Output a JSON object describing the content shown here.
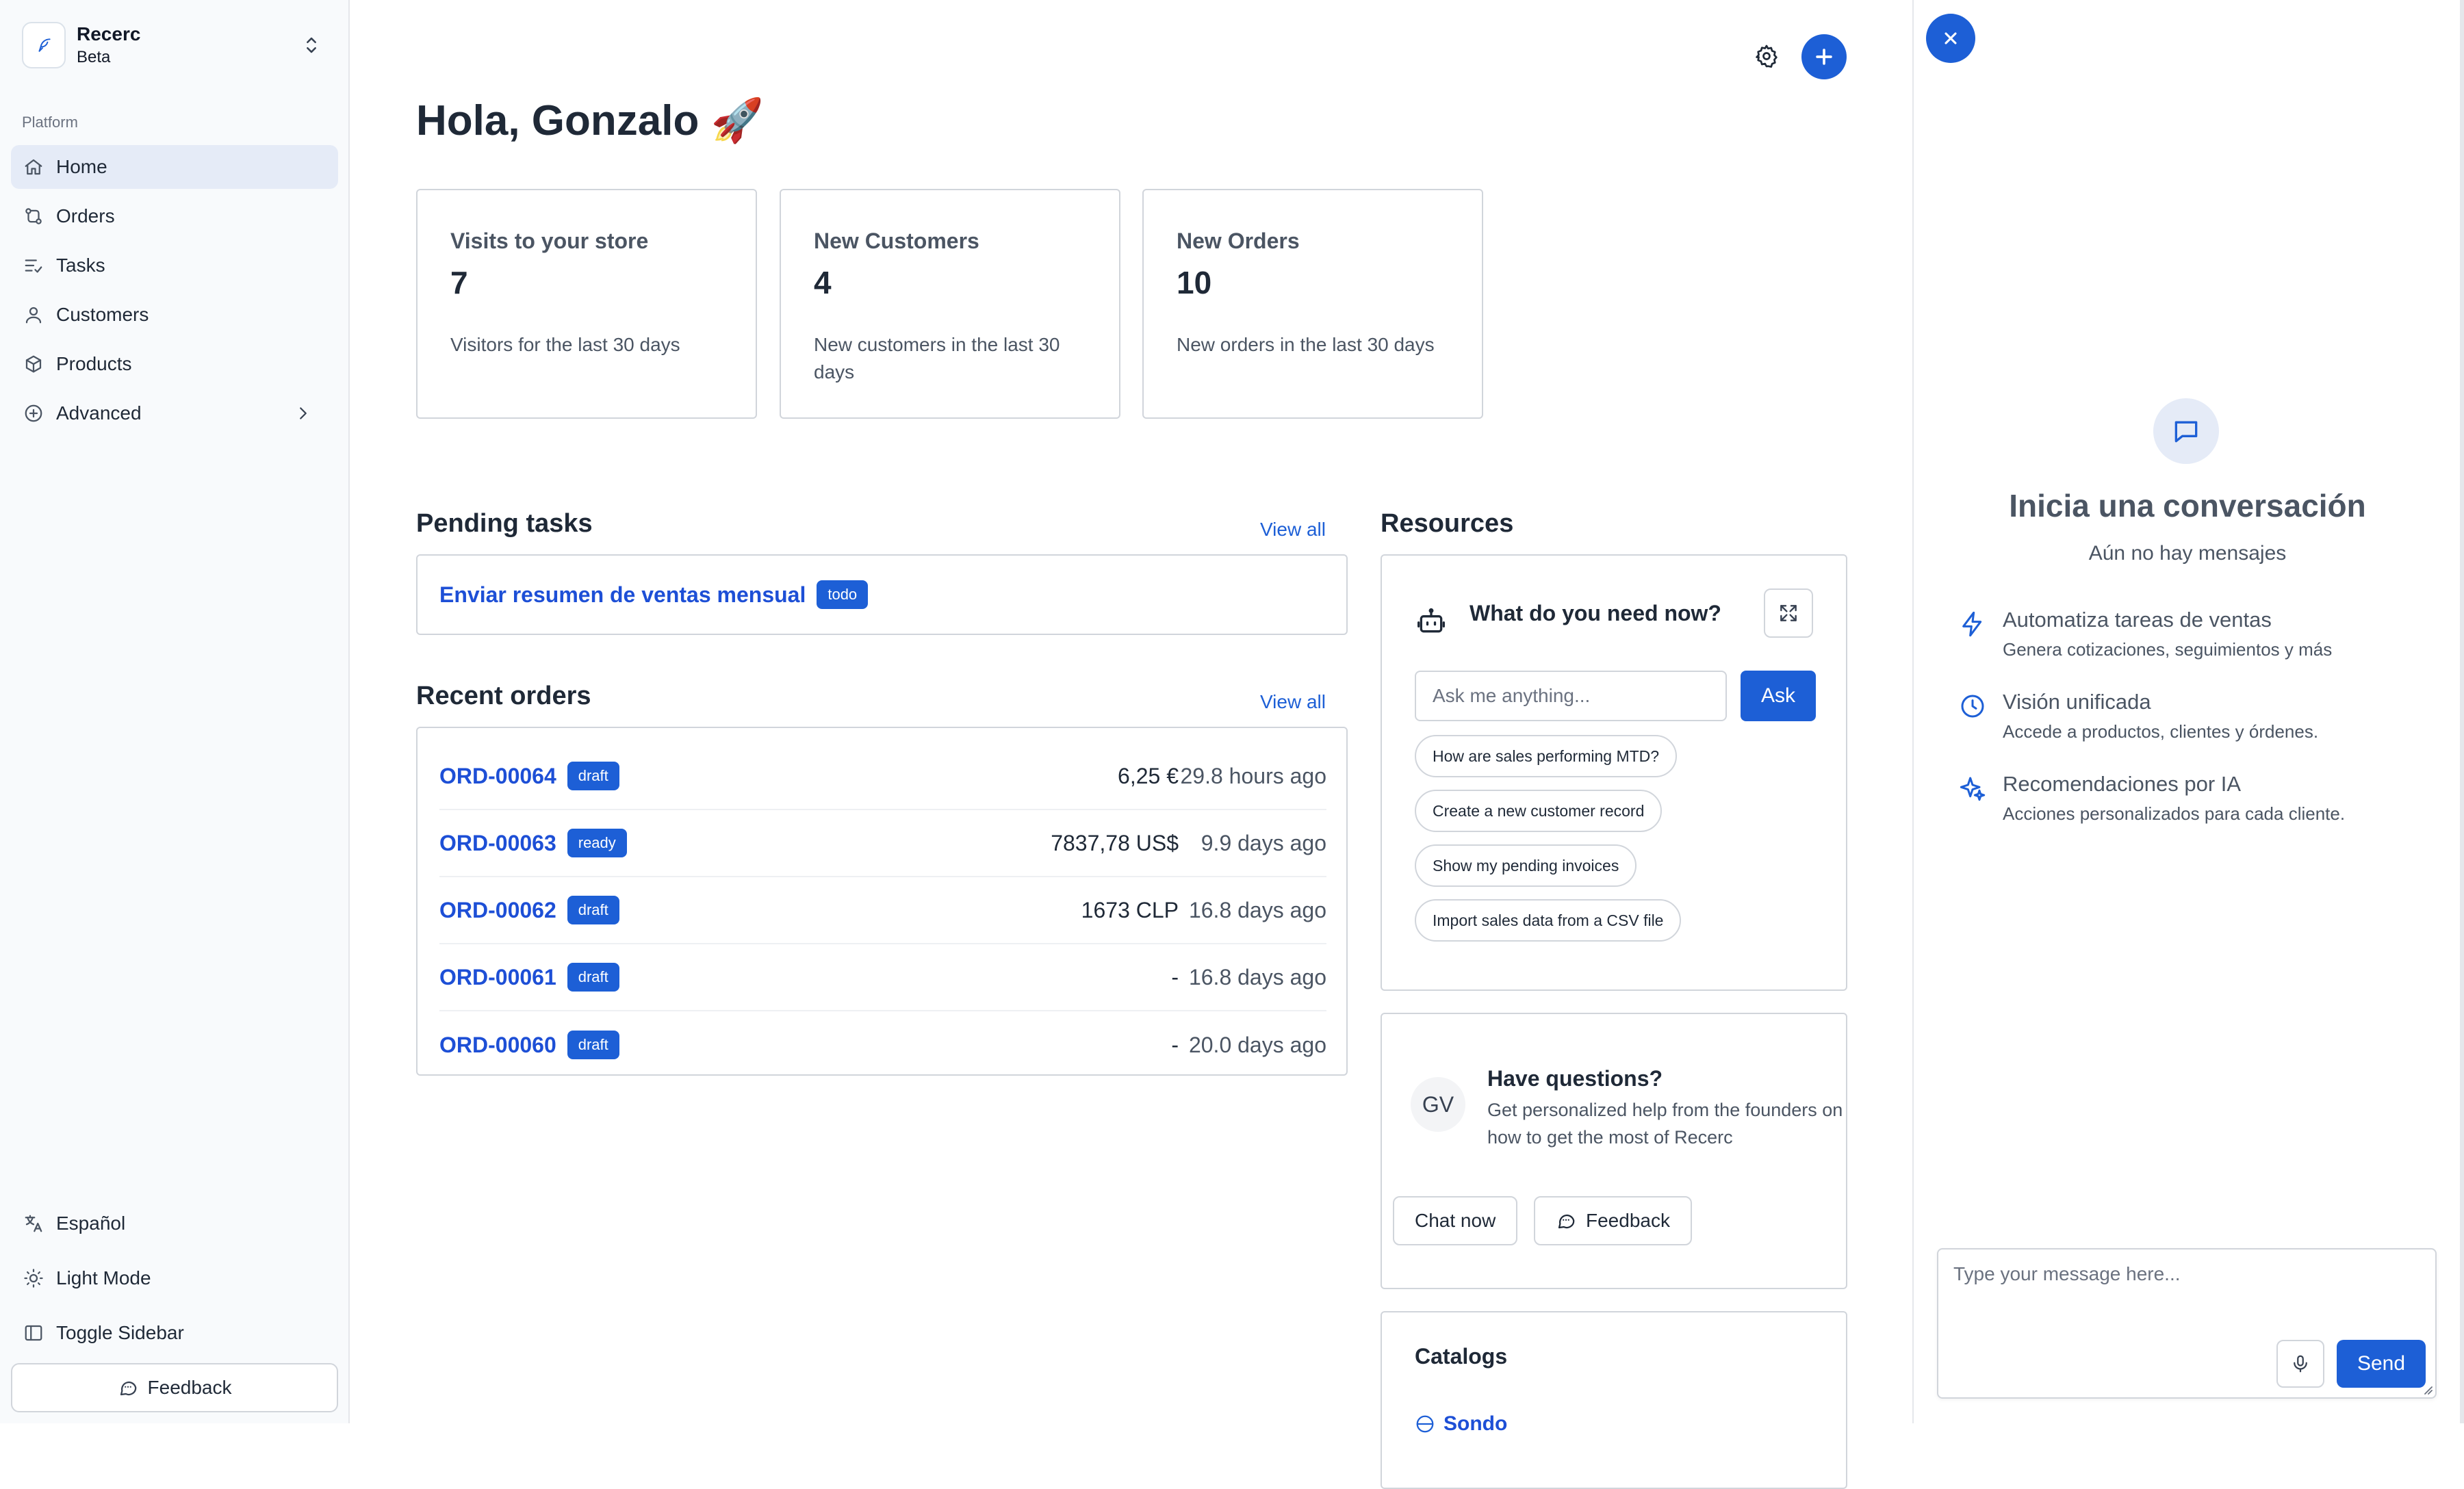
{
  "brand": {
    "name": "Recerc",
    "subtitle": "Beta"
  },
  "sidebar": {
    "section_label": "Platform",
    "items": [
      {
        "label": "Home",
        "icon": "home-icon",
        "active": true
      },
      {
        "label": "Orders",
        "icon": "orders-icon"
      },
      {
        "label": "Tasks",
        "icon": "tasks-icon"
      },
      {
        "label": "Customers",
        "icon": "user-icon"
      },
      {
        "label": "Products",
        "icon": "box-icon"
      },
      {
        "label": "Advanced",
        "icon": "plus-circle-icon",
        "has_chevron": true
      }
    ],
    "bottom": [
      {
        "label": "Español",
        "icon": "language-icon"
      },
      {
        "label": "Light Mode",
        "icon": "sun-icon"
      },
      {
        "label": "Toggle Sidebar",
        "icon": "sidebar-icon"
      }
    ],
    "feedback_label": "Feedback"
  },
  "main": {
    "greeting": "Hola, Gonzalo 🚀",
    "stats": [
      {
        "title": "Visits to your store",
        "value": "7",
        "desc": "Visitors for the last 30 days"
      },
      {
        "title": "New Customers",
        "value": "4",
        "desc": "New customers in the last 30 days"
      },
      {
        "title": "New Orders",
        "value": "10",
        "desc": "New orders in the last 30 days"
      }
    ],
    "pending": {
      "title": "Pending tasks",
      "view_all": "View all",
      "tasks": [
        {
          "title": "Enviar resumen de ventas mensual",
          "status": "todo"
        }
      ]
    },
    "recent": {
      "title": "Recent orders",
      "view_all": "View all",
      "orders": [
        {
          "id": "ORD-00064",
          "status": "draft",
          "amount": "6,25 €",
          "ago": "29.8 hours ago"
        },
        {
          "id": "ORD-00063",
          "status": "ready",
          "amount": "7837,78 US$",
          "ago": "9.9 days ago"
        },
        {
          "id": "ORD-00062",
          "status": "draft",
          "amount": "1673 CLP",
          "ago": "16.8 days ago"
        },
        {
          "id": "ORD-00061",
          "status": "draft",
          "amount": "-",
          "ago": "16.8 days ago"
        },
        {
          "id": "ORD-00060",
          "status": "draft",
          "amount": "-",
          "ago": "20.0 days ago"
        }
      ]
    },
    "resources": {
      "title": "Resources",
      "assistant": {
        "title": "What do you need now?",
        "placeholder": "Ask me anything...",
        "ask_label": "Ask",
        "suggestions": [
          "How are sales performing MTD?",
          "Create a new customer record",
          "Show my pending invoices",
          "Import sales data from a CSV file"
        ]
      },
      "help": {
        "initials": "GV",
        "title": "Have questions?",
        "desc": "Get personalized help from the founders on how to get the most of Recerc",
        "chat_label": "Chat now",
        "feedback_label": "Feedback"
      },
      "catalogs": {
        "title": "Catalogs",
        "first_item": "Sondo"
      }
    }
  },
  "chat": {
    "title": "Inicia una conversación",
    "subtitle": "Aún no hay mensajes",
    "features": [
      {
        "title": "Automatiza tareas de ventas",
        "desc": "Genera cotizaciones, seguimientos y más",
        "icon": "bolt-icon"
      },
      {
        "title": "Visión unificada",
        "desc": "Accede a productos, clientes y órdenes.",
        "icon": "clock-icon"
      },
      {
        "title": "Recomendaciones por IA",
        "desc": "Acciones personalizados para cada cliente.",
        "icon": "sparkles-icon"
      }
    ],
    "placeholder": "Type your message here...",
    "send_label": "Send"
  },
  "colors": {
    "accent": "#1d5fd6",
    "sidebar_bg": "#f8fafc",
    "active_bg": "#e5ebf7",
    "border": "#d1d5db"
  }
}
